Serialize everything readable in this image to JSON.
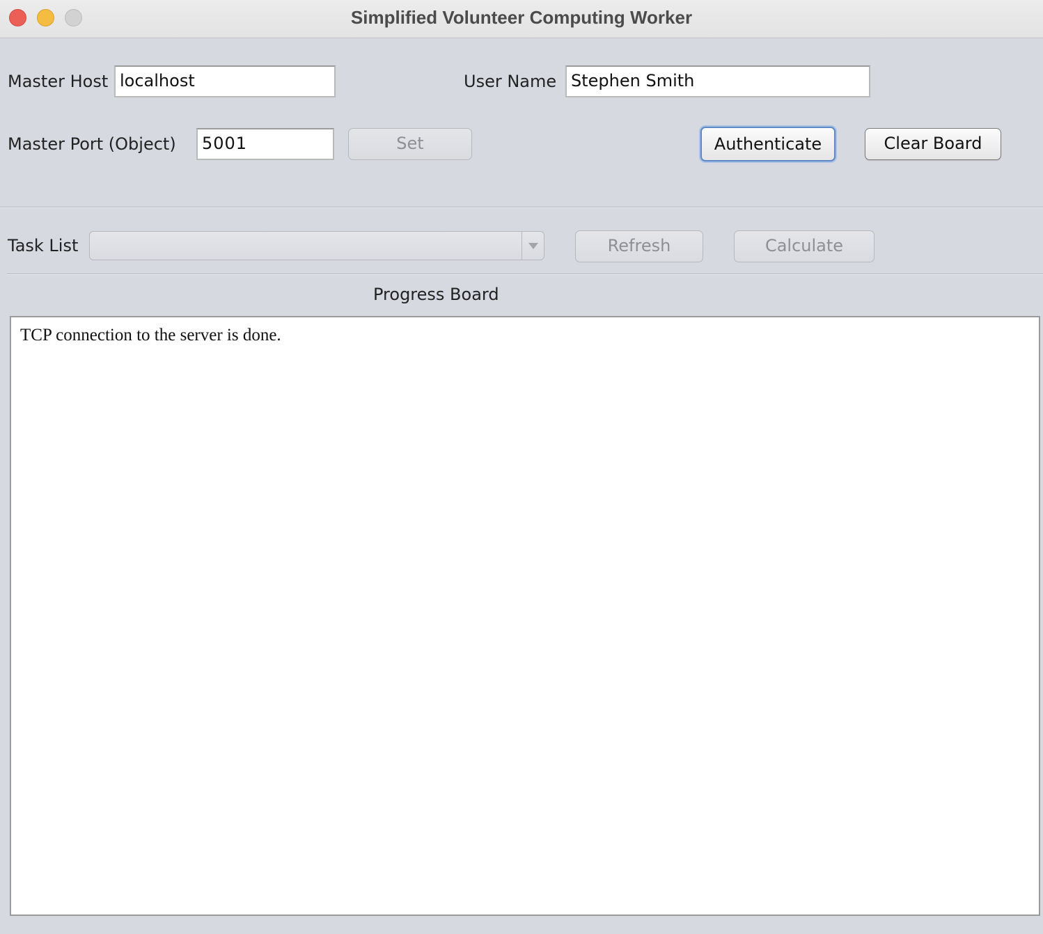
{
  "window": {
    "title": "Simplified Volunteer Computing Worker"
  },
  "form": {
    "master_host_label": "Master Host",
    "master_host_value": "localhost",
    "user_name_label": "User Name",
    "user_name_value": "Stephen Smith",
    "master_port_label": "Master Port (Object)",
    "master_port_value": "5001"
  },
  "buttons": {
    "set": "Set",
    "authenticate": "Authenticate",
    "clear_board": "Clear Board",
    "refresh": "Refresh",
    "calculate": "Calculate"
  },
  "task_list": {
    "label": "Task List",
    "selected": ""
  },
  "progress_board": {
    "title": "Progress Board",
    "lines": [
      "TCP connection to the server is done."
    ]
  }
}
